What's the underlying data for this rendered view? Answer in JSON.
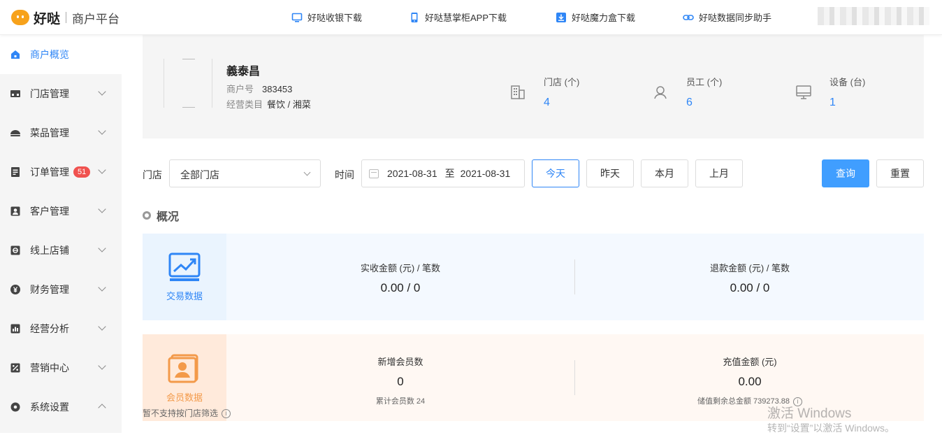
{
  "header": {
    "brand": "好哒",
    "platform": "商户平台",
    "links": [
      {
        "label": "好哒收银下载",
        "icon": "monitor-icon"
      },
      {
        "label": "好哒慧掌柜APP下载",
        "icon": "phone-icon"
      },
      {
        "label": "好哒魔力盒下载",
        "icon": "download-icon"
      },
      {
        "label": "好哒数据同步助手",
        "icon": "link-icon"
      }
    ]
  },
  "sidebar": {
    "items": [
      {
        "label": "商户概览",
        "icon": "home-icon",
        "active": true
      },
      {
        "label": "门店管理",
        "icon": "store-icon"
      },
      {
        "label": "菜品管理",
        "icon": "dish-icon"
      },
      {
        "label": "订单管理",
        "icon": "order-icon",
        "badge": "51"
      },
      {
        "label": "客户管理",
        "icon": "customer-icon"
      },
      {
        "label": "线上店铺",
        "icon": "online-shop-icon"
      },
      {
        "label": "财务管理",
        "icon": "yuan-icon"
      },
      {
        "label": "经营分析",
        "icon": "bar-chart-icon"
      },
      {
        "label": "营销中心",
        "icon": "discount-icon"
      },
      {
        "label": "系统设置",
        "icon": "gear-icon"
      }
    ]
  },
  "merchant": {
    "name": "義泰昌",
    "id_label": "商户号",
    "id_value": "383453",
    "category_label": "经营类目",
    "category_value": "餐饮 / 湘菜"
  },
  "stats": [
    {
      "label": "门店 (个)",
      "value": "4",
      "icon": "building-icon"
    },
    {
      "label": "员工 (个)",
      "value": "6",
      "icon": "person-icon"
    },
    {
      "label": "设备 (台)",
      "value": "1",
      "icon": "device-icon"
    }
  ],
  "filters": {
    "store_label": "门店",
    "store_value": "全部门店",
    "time_label": "时间",
    "date_start": "2021-08-31",
    "date_sep": "至",
    "date_end": "2021-08-31",
    "quick": [
      "今天",
      "昨天",
      "本月",
      "上月"
    ],
    "selected_quick": "今天",
    "query_label": "查询",
    "reset_label": "重置"
  },
  "overview": {
    "title": "概况",
    "transactions": {
      "tag": "交易数据",
      "received_label": "实收金额 (元) / 笔数",
      "received_value": "0.00 / 0",
      "refund_label": "退款金额 (元) / 笔数",
      "refund_value": "0.00 / 0"
    },
    "members": {
      "tag": "会员数据",
      "new_label": "新增会员数",
      "new_value": "0",
      "total_text": "累计会员数 24",
      "recharge_label": "充值金额 (元)",
      "recharge_value": "0.00",
      "balance_text": "储值剩余总金额 739273.88",
      "note": "暂不支持按门店筛选"
    }
  },
  "watermark": {
    "line1": "激活 Windows",
    "line2": "转到“设置”以激活 Windows。"
  },
  "colors": {
    "accent": "#2f86f6",
    "primary_button": "#409eff",
    "member_orange": "#f39a4a",
    "badge": "#f0524f"
  }
}
